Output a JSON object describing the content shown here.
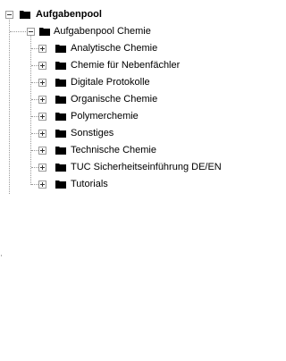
{
  "tree": {
    "root": {
      "label": "Aufgabenpool",
      "expanded": true,
      "icon": "folder-icon",
      "children": [
        {
          "label": "Aufgabenpool Chemie",
          "expanded": true,
          "icon": "folder-icon",
          "children": [
            {
              "label": "Analytische Chemie",
              "expanded": false,
              "icon": "folder-icon"
            },
            {
              "label": "Chemie für Nebenfächler",
              "expanded": false,
              "icon": "folder-icon"
            },
            {
              "label": "Digitale Protokolle",
              "expanded": false,
              "icon": "folder-icon"
            },
            {
              "label": "Organische Chemie",
              "expanded": false,
              "icon": "folder-icon"
            },
            {
              "label": "Polymerchemie",
              "expanded": false,
              "icon": "folder-icon"
            },
            {
              "label": "Sonstiges",
              "expanded": false,
              "icon": "folder-icon"
            },
            {
              "label": "Technische Chemie",
              "expanded": false,
              "icon": "folder-icon"
            },
            {
              "label": "TUC Sicherheitseinführung DE/EN",
              "expanded": false,
              "icon": "folder-icon"
            },
            {
              "label": "Tutorials",
              "expanded": false,
              "icon": "folder-icon"
            }
          ]
        }
      ]
    }
  },
  "colors": {
    "folder": "#000000",
    "connector": "#9a9a9a",
    "background": "#ffffff",
    "text": "#000000"
  }
}
